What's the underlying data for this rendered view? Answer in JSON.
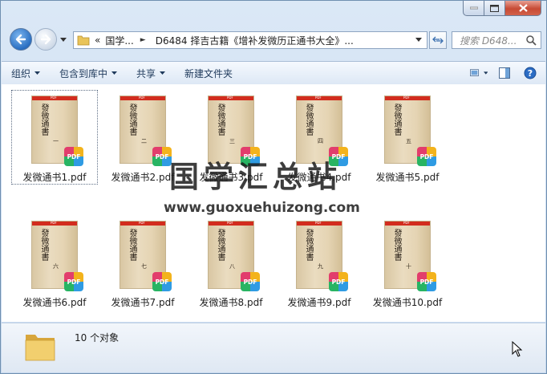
{
  "address": {
    "back_chevrons": "«",
    "crumb_root": "国学...",
    "crumb_current": "D6484 择吉古籍《增补发微历正通书大全》..."
  },
  "search": {
    "placeholder": "搜索 D648..."
  },
  "toolbar": {
    "organize": "组织",
    "include_library": "包含到库中",
    "share": "共享",
    "new_folder": "新建文件夹"
  },
  "files": [
    {
      "name": "发微通书1.pdf",
      "vol": "一"
    },
    {
      "name": "发微通书2.pdf",
      "vol": "二"
    },
    {
      "name": "发微通书3.pdf",
      "vol": "三"
    },
    {
      "name": "发微通书4.pdf",
      "vol": "四"
    },
    {
      "name": "发微通书5.pdf",
      "vol": "五"
    },
    {
      "name": "发微通书6.pdf",
      "vol": "六"
    },
    {
      "name": "发微通书7.pdf",
      "vol": "七"
    },
    {
      "name": "发微通书8.pdf",
      "vol": "八"
    },
    {
      "name": "发微通书9.pdf",
      "vol": "九"
    },
    {
      "name": "发微通书10.pdf",
      "vol": "十"
    }
  ],
  "thumb": {
    "cover_title": "發微通書",
    "red_label": "PDF",
    "badge": "PDF"
  },
  "watermark": {
    "title": "国学汇总站",
    "url": "www.guoxuehuizong.com"
  },
  "status": {
    "count": "10 个对象"
  },
  "colors": {
    "accent": "#1e395b",
    "pdf_red": "#d22c1e",
    "window_frame": "#6f8fb0"
  }
}
